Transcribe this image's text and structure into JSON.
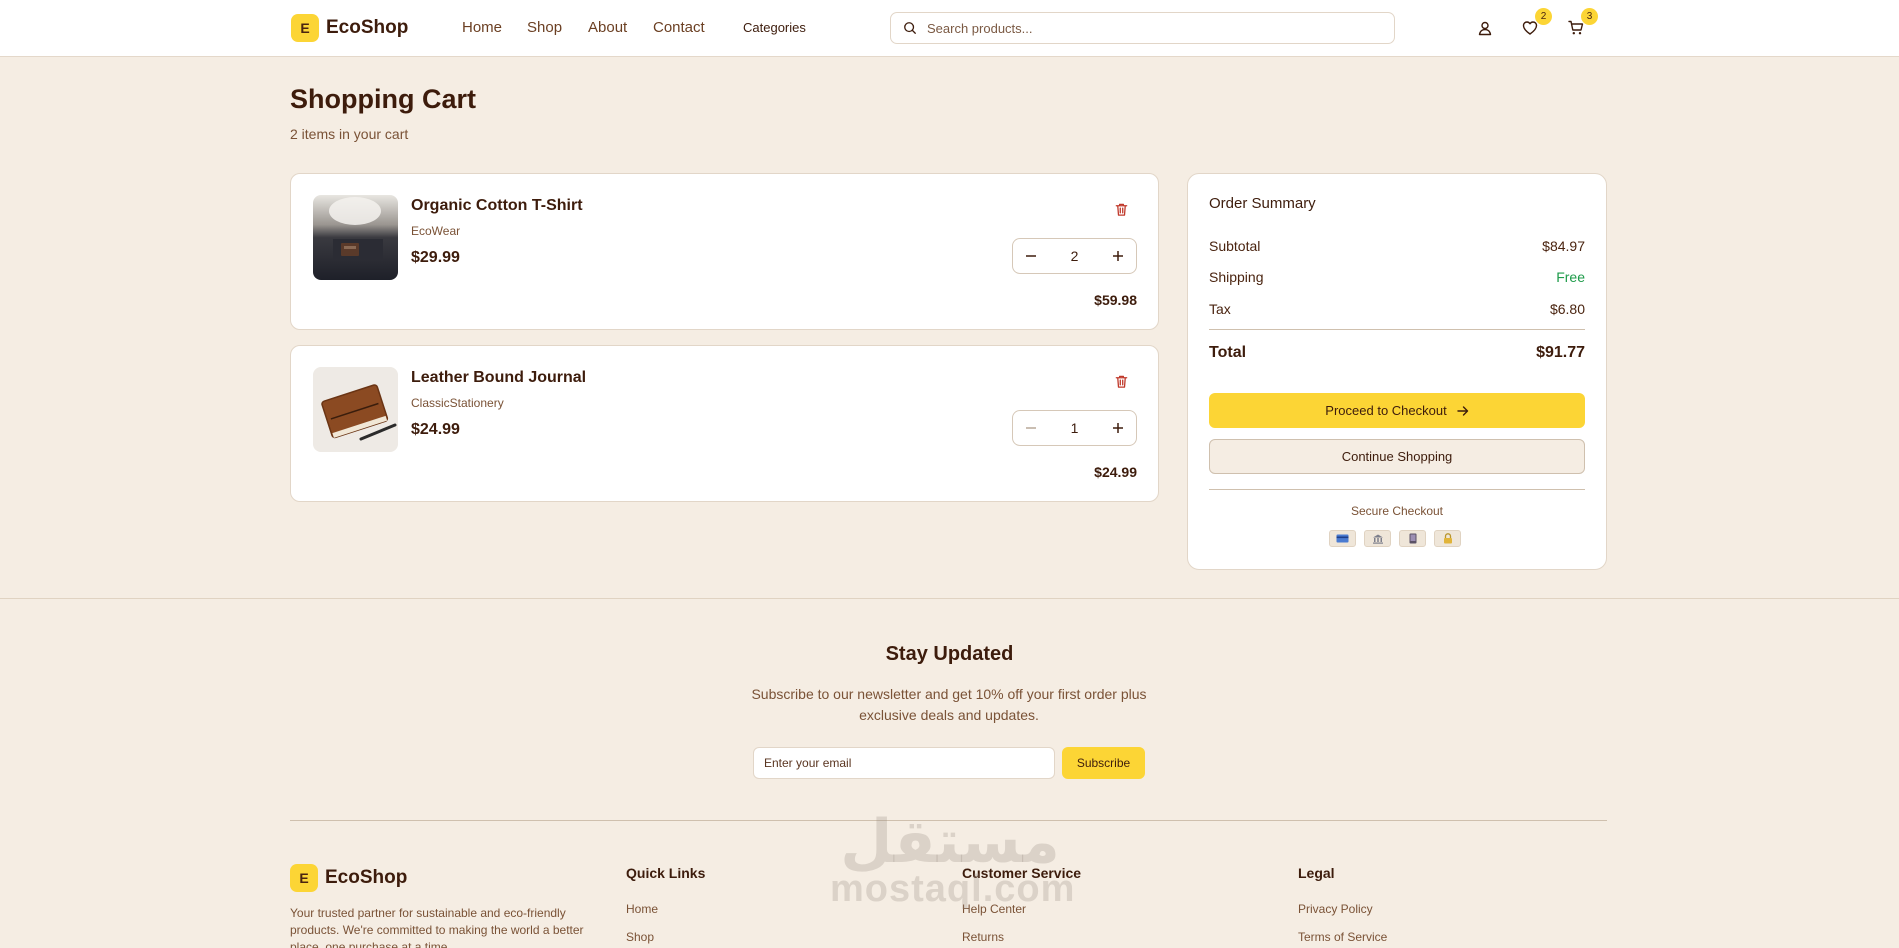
{
  "header": {
    "logo_letter": "E",
    "logo_text": "EcoShop",
    "nav": [
      "Home",
      "Shop",
      "About",
      "Contact"
    ],
    "categories_label": "Categories",
    "search_placeholder": "Search products...",
    "wishlist_count": "2",
    "cart_count": "3"
  },
  "page": {
    "title": "Shopping Cart",
    "subtitle": "2 items in your cart"
  },
  "cart_items": [
    {
      "name": "Organic Cotton T-Shirt",
      "brand": "EcoWear",
      "price": "$29.99",
      "quantity": "2",
      "line_total": "$59.98"
    },
    {
      "name": "Leather Bound Journal",
      "brand": "ClassicStationery",
      "price": "$24.99",
      "quantity": "1",
      "line_total": "$24.99"
    }
  ],
  "summary": {
    "title": "Order Summary",
    "subtotal_label": "Subtotal",
    "subtotal_value": "$84.97",
    "shipping_label": "Shipping",
    "shipping_value": "Free",
    "tax_label": "Tax",
    "tax_value": "$6.80",
    "total_label": "Total",
    "total_value": "$91.77",
    "checkout_label": "Proceed to Checkout",
    "continue_label": "Continue Shopping",
    "secure_label": "Secure Checkout",
    "payment_icons": [
      "credit-card-icon",
      "bank-icon",
      "mobile-pay-icon",
      "lock-icon"
    ]
  },
  "newsletter": {
    "title": "Stay Updated",
    "text": "Subscribe to our newsletter and get 10% off your first order plus exclusive deals and updates.",
    "email_placeholder": "Enter your email",
    "subscribe_label": "Subscribe"
  },
  "footer": {
    "logo_letter": "E",
    "logo_text": "EcoShop",
    "description": "Your trusted partner for sustainable and eco-friendly products. We're committed to making the world a better place, one purchase at a time.",
    "quick_links_title": "Quick Links",
    "quick_links": [
      "Home",
      "Shop"
    ],
    "customer_service_title": "Customer Service",
    "customer_service": [
      "Help Center",
      "Returns"
    ],
    "legal_title": "Legal",
    "legal": [
      "Privacy Policy",
      "Terms of Service"
    ]
  },
  "watermark": {
    "arabic": "مستقل",
    "latin": "mostaql.com"
  },
  "colors": {
    "accent": "#fcd535",
    "background": "#f5ede3",
    "text": "#3d1c0c",
    "free": "#1e9b4a",
    "trash": "#c0392b"
  }
}
